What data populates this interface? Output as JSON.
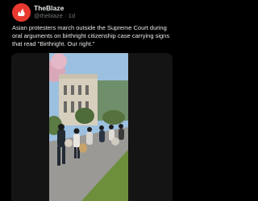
{
  "post": {
    "author_name": "TheBlaze",
    "author_handle": "@theblaze",
    "separator": "·",
    "timestamp": "1d",
    "text": "Asian protesters march outside the Supreme Court during oral arguments on birthright citizenship case carrying signs that read \"Birthright. Our right.\"",
    "avatar_icon": "theblaze-logo-icon",
    "avatar_color": "#e8392f"
  },
  "media": {
    "type": "video",
    "description_icon": "video-thumbnail"
  },
  "colors": {
    "background": "#000000",
    "text_primary": "#e7e9ea",
    "text_secondary": "#71767b",
    "media_background": "#141414"
  }
}
